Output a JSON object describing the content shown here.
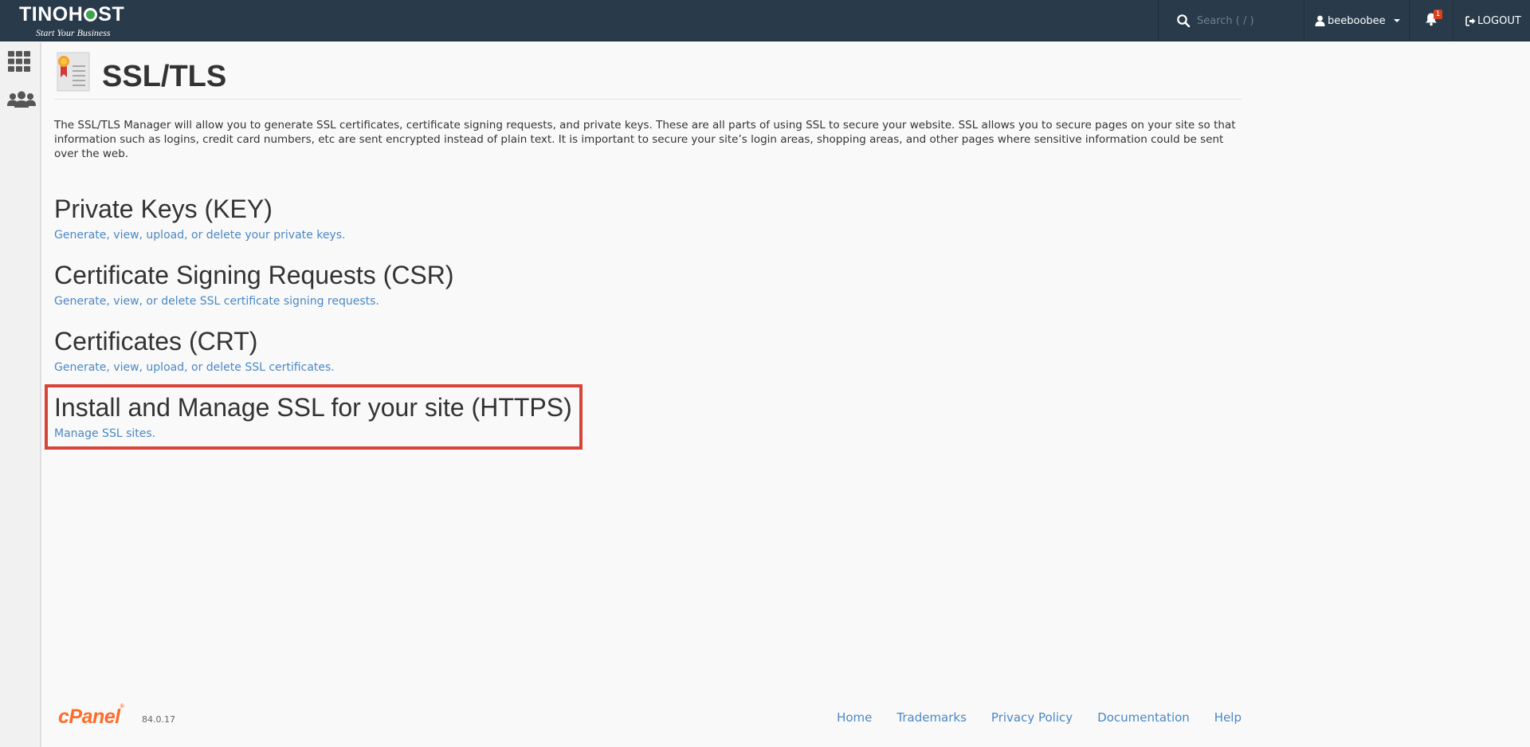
{
  "brand": {
    "name_left": "TINO",
    "name_mid": "H",
    "name_right": "ST",
    "tagline": "Start Your Business"
  },
  "topbar": {
    "search_placeholder": "Search ( / )",
    "username": "beeboobee",
    "notification_count": "1",
    "logout_label": "LOGOUT"
  },
  "sidebar": {
    "items": [
      {
        "icon": "grid-icon"
      },
      {
        "icon": "users-icon"
      }
    ]
  },
  "page": {
    "title": "SSL/TLS",
    "description": "The SSL/TLS Manager will allow you to generate SSL certificates, certificate signing requests, and private keys. These are all parts of using SSL to secure your website. SSL allows you to secure pages on your site so that information such as logins, credit card numbers, etc are sent encrypted instead of plain text. It is important to secure your site’s login areas, shopping areas, and other pages where sensitive information could be sent over the web."
  },
  "sections": [
    {
      "heading": "Private Keys (KEY)",
      "link": "Generate, view, upload, or delete your private keys."
    },
    {
      "heading": "Certificate Signing Requests (CSR)",
      "link": "Generate, view, or delete SSL certificate signing requests."
    },
    {
      "heading": "Certificates (CRT)",
      "link": "Generate, view, upload, or delete SSL certificates."
    },
    {
      "heading": "Install and Manage SSL for your site (HTTPS)",
      "link": "Manage SSL sites."
    }
  ],
  "footer": {
    "logo": "cPanel",
    "version": "84.0.17",
    "links": [
      "Home",
      "Trademarks",
      "Privacy Policy",
      "Documentation",
      "Help"
    ]
  },
  "colors": {
    "topbar": "#293a4a",
    "link": "#4a88c6",
    "highlight": "#d9443a",
    "cpanel_orange": "#ff6c2c"
  }
}
